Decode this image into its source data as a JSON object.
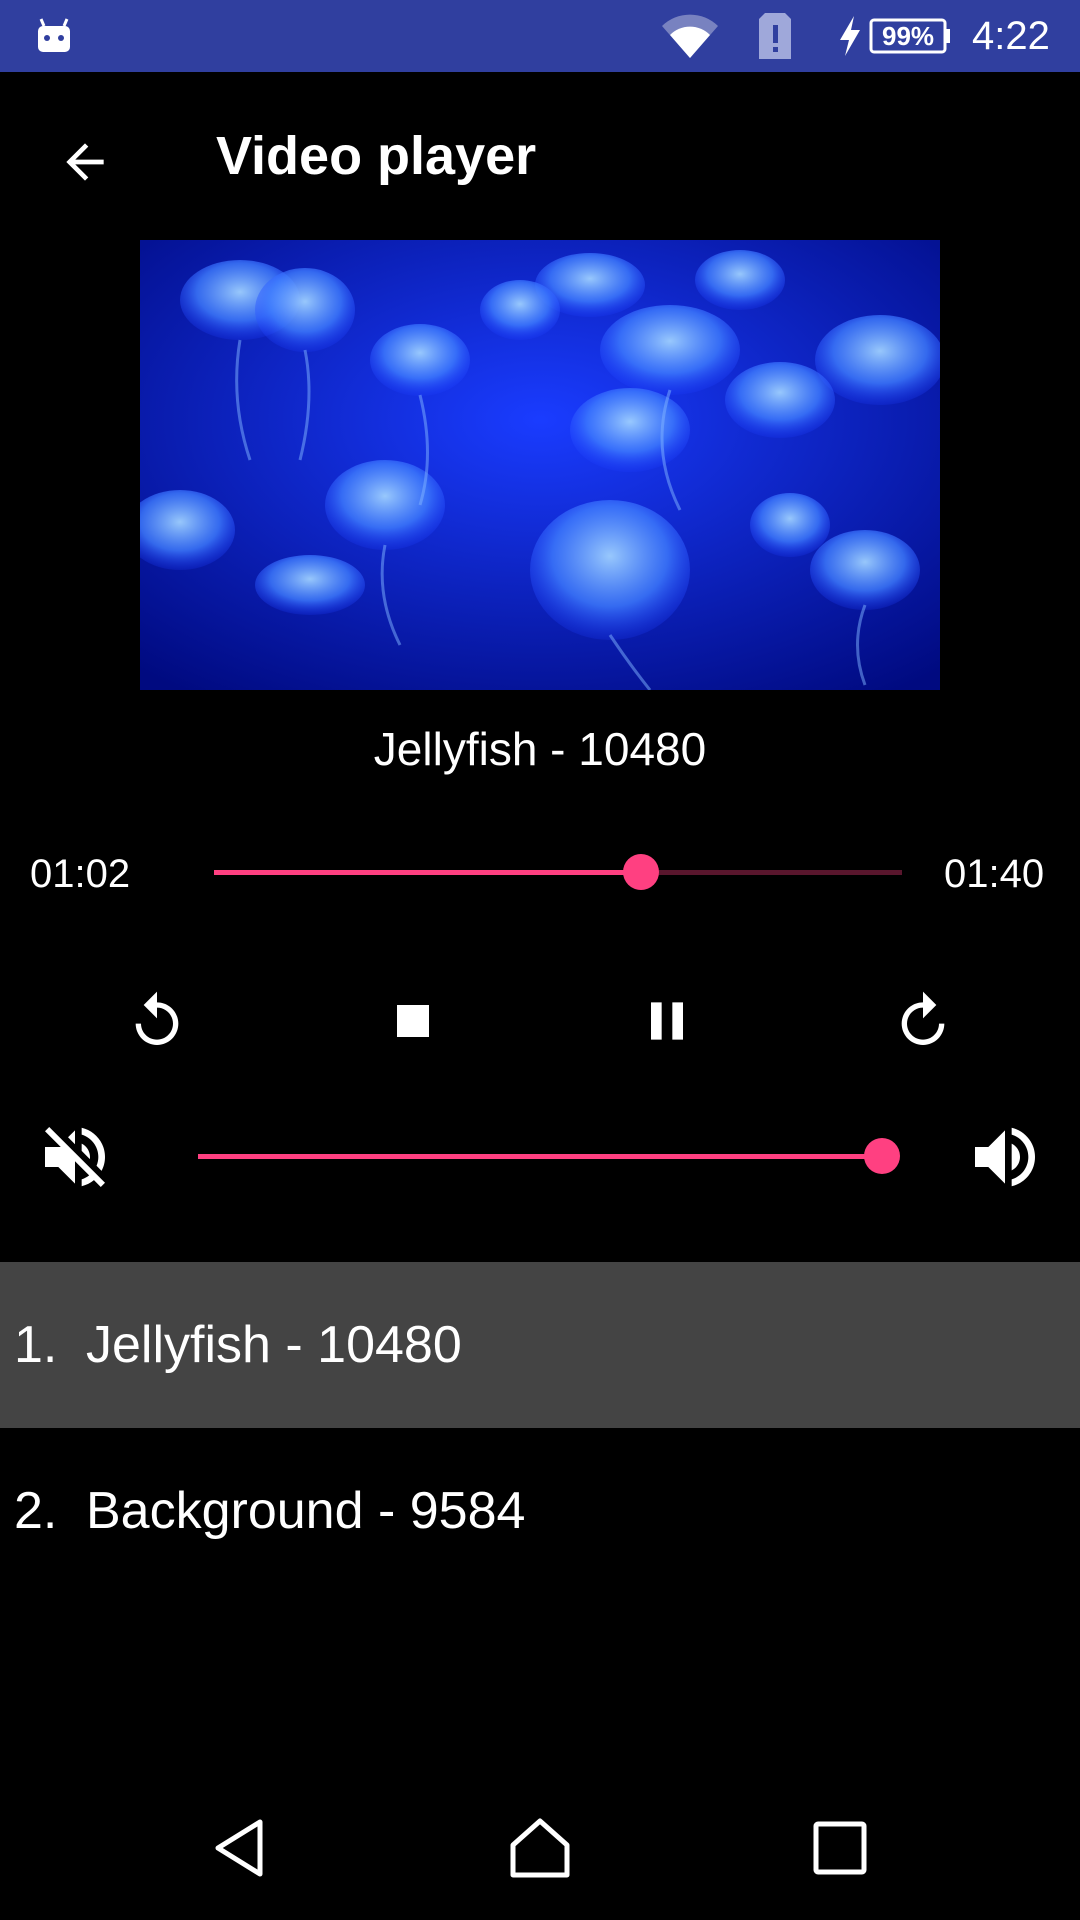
{
  "status_bar": {
    "time": "4:22",
    "battery_percent": "99%",
    "icons": [
      "android-debug-icon",
      "wifi-icon",
      "sim-alert-icon",
      "charging-icon",
      "battery-icon"
    ]
  },
  "app_bar": {
    "title": "Video player",
    "back_icon": "arrow-back-icon"
  },
  "player": {
    "now_playing": "Jellyfish - 10480",
    "elapsed": "01:02",
    "duration": "01:40",
    "progress_fraction": 0.62,
    "volume_fraction": 1.0
  },
  "controls": {
    "icons": [
      "replay-icon",
      "stop-icon",
      "pause-icon",
      "forward-icon",
      "volume-off-icon",
      "volume-up-icon"
    ]
  },
  "playlist": {
    "items": [
      {
        "index": "1.",
        "title": "Jellyfish - 10480",
        "active": true
      },
      {
        "index": "2.",
        "title": "Background - 9584",
        "active": false
      }
    ]
  },
  "colors": {
    "status_bar": "#303f9f",
    "accent": "#ff4081",
    "active_row": "#444444",
    "background": "#000000"
  }
}
